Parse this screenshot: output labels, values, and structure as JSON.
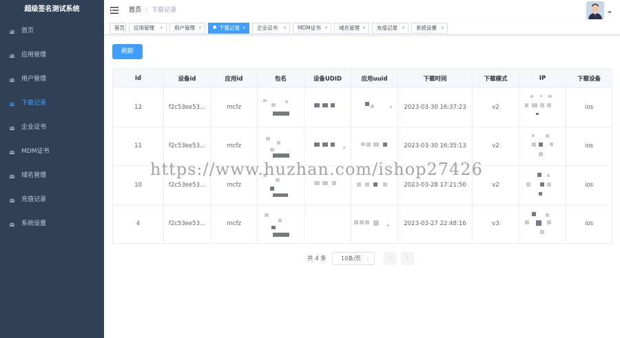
{
  "app": {
    "title": "超级签名测试系统"
  },
  "sidebar": {
    "items": [
      {
        "label": "首页",
        "icon": "dashboard-icon",
        "active": false
      },
      {
        "label": "应用管理",
        "icon": "dashboard-icon",
        "active": false
      },
      {
        "label": "用户管理",
        "icon": "dashboard-icon",
        "active": false
      },
      {
        "label": "下载记录",
        "icon": "dashboard-icon",
        "active": true
      },
      {
        "label": "企业证书",
        "icon": "dashboard-icon",
        "active": false
      },
      {
        "label": "MDM证书",
        "icon": "dashboard-icon",
        "active": false
      },
      {
        "label": "域名管理",
        "icon": "dashboard-icon",
        "active": false
      },
      {
        "label": "充值记录",
        "icon": "dashboard-icon",
        "active": false
      },
      {
        "label": "系统设置",
        "icon": "dashboard-icon",
        "active": false
      }
    ]
  },
  "navbar": {
    "breadcrumb": {
      "home": "首页",
      "separator": "/",
      "current": "下载记录"
    }
  },
  "tags": [
    {
      "label": "首页",
      "closable": false,
      "active": false
    },
    {
      "label": "应用管理",
      "closable": true,
      "active": false
    },
    {
      "label": "用户管理",
      "closable": true,
      "active": false
    },
    {
      "label": "下载记录",
      "closable": true,
      "active": true
    },
    {
      "label": "企业证书",
      "closable": true,
      "active": false
    },
    {
      "label": "MDM证书",
      "closable": true,
      "active": false
    },
    {
      "label": "域名管理",
      "closable": true,
      "active": false
    },
    {
      "label": "充值记录",
      "closable": true,
      "active": false
    },
    {
      "label": "系统设置",
      "closable": true,
      "active": false
    }
  ],
  "toolbar": {
    "refresh_label": "刷新"
  },
  "table": {
    "columns": [
      "id",
      "设备id",
      "应用id",
      "包名",
      "设备UDID",
      "应用uuid",
      "下载时间",
      "下载模式",
      "IP",
      "下载设备"
    ],
    "rows": [
      {
        "id": "12",
        "device_id": "f2c53ee53...",
        "app_id": "rncfz",
        "download_time": "2023-03-30 16:37:23",
        "mode": "v2",
        "device": "ios"
      },
      {
        "id": "11",
        "device_id": "f2c53ee53...",
        "app_id": "rncfz",
        "download_time": "2023-03-30 16:35:13",
        "mode": "v2",
        "device": "ios"
      },
      {
        "id": "10",
        "device_id": "f2c53ee53...",
        "app_id": "rncfz",
        "download_time": "2023-03-28 17:21:50",
        "mode": "v2",
        "device": "ios"
      },
      {
        "id": "4",
        "device_id": "f2c53ee53...",
        "app_id": "rncfz",
        "download_time": "2023-03-27 22:48:16",
        "mode": "v3",
        "device": "ios"
      }
    ]
  },
  "pagination": {
    "total_text": "共 4 条",
    "page_size": "10条/页",
    "prev": "‹",
    "next": "›"
  },
  "watermark": "https://www.huzhan.com/ishop27426",
  "colors": {
    "sidebar_bg": "#304156",
    "accent": "#409eff",
    "sidebar_text": "#bfcbd9"
  }
}
